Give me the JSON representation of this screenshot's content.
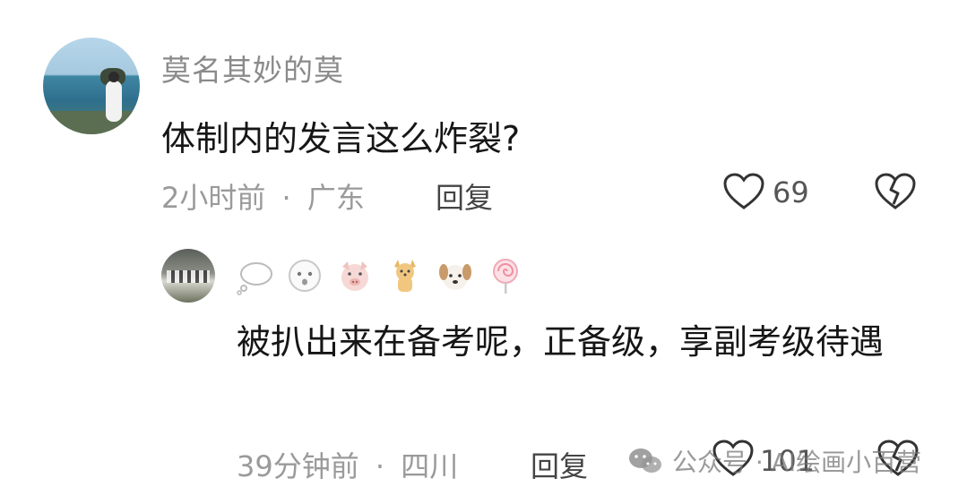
{
  "comment": {
    "username": "莫名其妙的莫",
    "text": "体制内的发言这么炸裂?",
    "time": "2小时前",
    "separator": "·",
    "location": "广东",
    "reply_label": "回复",
    "like_count": "69"
  },
  "reply": {
    "username_emojis": [
      "thought-bubble-icon",
      "ghost-icon",
      "pig-face-icon",
      "dog-icon",
      "dog-face-icon",
      "lollipop-icon"
    ],
    "text": "被扒出来在备考呢，正备级，享副考级待遇",
    "time": "39分钟前",
    "separator": "·",
    "location": "四川",
    "reply_label": "回复",
    "like_count": "101"
  },
  "watermark": {
    "text": "公众号 · AI绘画小百营"
  }
}
